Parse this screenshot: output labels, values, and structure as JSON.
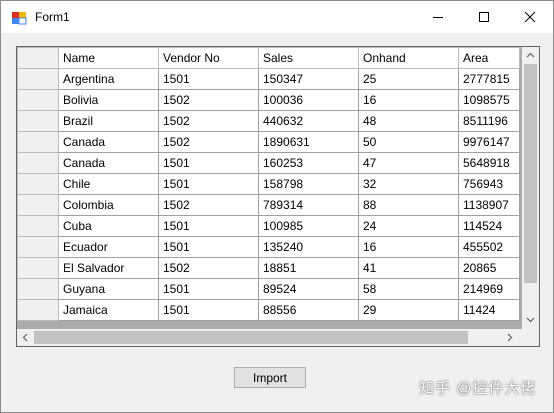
{
  "window": {
    "title": "Form1"
  },
  "grid": {
    "columns": [
      "Name",
      "Vendor No",
      "Sales",
      "Onhand",
      "Area"
    ],
    "rows": [
      [
        "Argentina",
        "1501",
        "150347",
        "25",
        "2777815"
      ],
      [
        "Bolivia",
        "1502",
        "100036",
        "16",
        "1098575"
      ],
      [
        "Brazil",
        "1502",
        "440632",
        "48",
        "8511196"
      ],
      [
        "Canada",
        "1502",
        "1890631",
        "50",
        "9976147"
      ],
      [
        "Canada",
        "1501",
        "160253",
        "47",
        "5648918"
      ],
      [
        "Chile",
        "1501",
        "158798",
        "32",
        "756943"
      ],
      [
        "Colombia",
        "1502",
        "789314",
        "88",
        "1138907"
      ],
      [
        "Cuba",
        "1501",
        "100985",
        "24",
        "114524"
      ],
      [
        "Ecuador",
        "1501",
        "135240",
        "16",
        "455502"
      ],
      [
        "El Salvador",
        "1502",
        "18851",
        "41",
        "20865"
      ],
      [
        "Guyana",
        "1501",
        "89524",
        "58",
        "214969"
      ],
      [
        "Jamaica",
        "1501",
        "88556",
        "29",
        "11424"
      ]
    ]
  },
  "buttons": {
    "import_label": "Import"
  },
  "watermark": "知乎 @控件大佬",
  "icons": {
    "app": "form-app-icon",
    "minimize": "minimize-icon",
    "maximize": "maximize-icon",
    "close": "close-icon"
  }
}
